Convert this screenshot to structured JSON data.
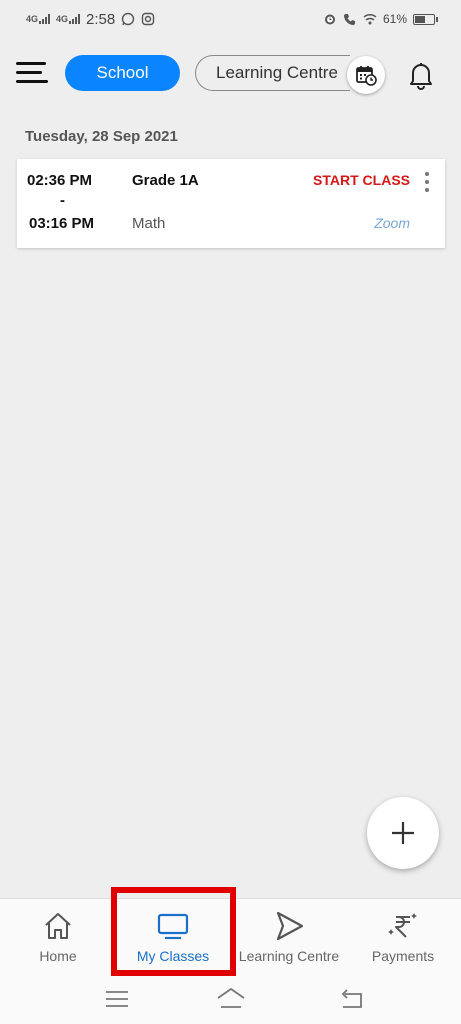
{
  "status_bar": {
    "network1": "4G",
    "network2": "4G",
    "time": "2:58",
    "battery": "61%",
    "battery_level": 0.61
  },
  "header": {
    "menu_icon": "hamburger-icon",
    "tabs": [
      {
        "label": "School",
        "active": true
      },
      {
        "label": "Learning Centre",
        "active": false
      }
    ],
    "calendar_icon": "calendar-clock-icon",
    "notification_icon": "bell-icon"
  },
  "schedule": {
    "date": "Tuesday, 28 Sep 2021",
    "classes": [
      {
        "start_time": "02:36 PM",
        "separator": "-",
        "end_time": "03:16 PM",
        "grade": "Grade 1A",
        "subject": "Math",
        "action": "START CLASS",
        "platform": "Zoom"
      }
    ]
  },
  "fab": {
    "icon": "plus-icon"
  },
  "bottom_nav": {
    "items": [
      {
        "label": "Home",
        "icon": "home-icon",
        "active": false
      },
      {
        "label": "My Classes",
        "icon": "monitor-icon",
        "active": true
      },
      {
        "label": "Learning Centre",
        "icon": "play-icon",
        "active": false
      },
      {
        "label": "Payments",
        "icon": "rupee-icon",
        "active": false
      }
    ]
  },
  "colors": {
    "primary": "#0a84ff",
    "active_nav": "#1a6fc9",
    "start_class": "#d51818",
    "highlight_box": "#e00000",
    "background": "#eeeeee"
  }
}
